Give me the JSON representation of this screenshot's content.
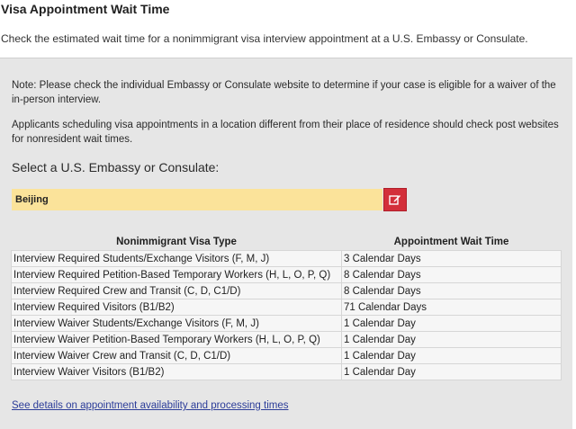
{
  "page": {
    "title": "Visa Appointment Wait Time",
    "intro": "Check the estimated wait time for a nonimmigrant visa interview appointment at a U.S. Embassy or Consulate."
  },
  "panel": {
    "note1": "Note: Please check the individual Embassy or Consulate website to determine if your case is eligible for a waiver of the in-person interview.",
    "note2": "Applicants scheduling visa appointments in a location different from their place of residence should check post websites for nonresident wait times.",
    "select_heading": "Select a U.S. Embassy or Consulate:",
    "selected_post": "Beijing",
    "edit_icon": "edit-icon",
    "accent_color": "#d32f3a",
    "select_bg_color": "#fbe39a"
  },
  "table": {
    "headers": [
      "Nonimmigrant Visa Type",
      "Appointment Wait Time"
    ],
    "rows": [
      [
        "Interview Required Students/Exchange Visitors (F, M, J)",
        "3 Calendar Days"
      ],
      [
        "Interview Required Petition-Based Temporary Workers (H, L, O, P, Q)",
        "8 Calendar Days"
      ],
      [
        "Interview Required Crew and Transit (C, D, C1/D)",
        "8 Calendar Days"
      ],
      [
        "Interview Required Visitors (B1/B2)",
        "71 Calendar Days"
      ],
      [
        "Interview Waiver Students/Exchange Visitors (F, M, J)",
        "1 Calendar Day"
      ],
      [
        "Interview Waiver Petition-Based Temporary Workers (H, L, O, P, Q)",
        "1 Calendar Day"
      ],
      [
        "Interview Waiver Crew and Transit (C, D, C1/D)",
        "1 Calendar Day"
      ],
      [
        "Interview Waiver Visitors (B1/B2)",
        "1 Calendar Day"
      ]
    ]
  },
  "footer": {
    "details_link": "See details on appointment availability and processing times",
    "link_color": "#2c3d99"
  }
}
